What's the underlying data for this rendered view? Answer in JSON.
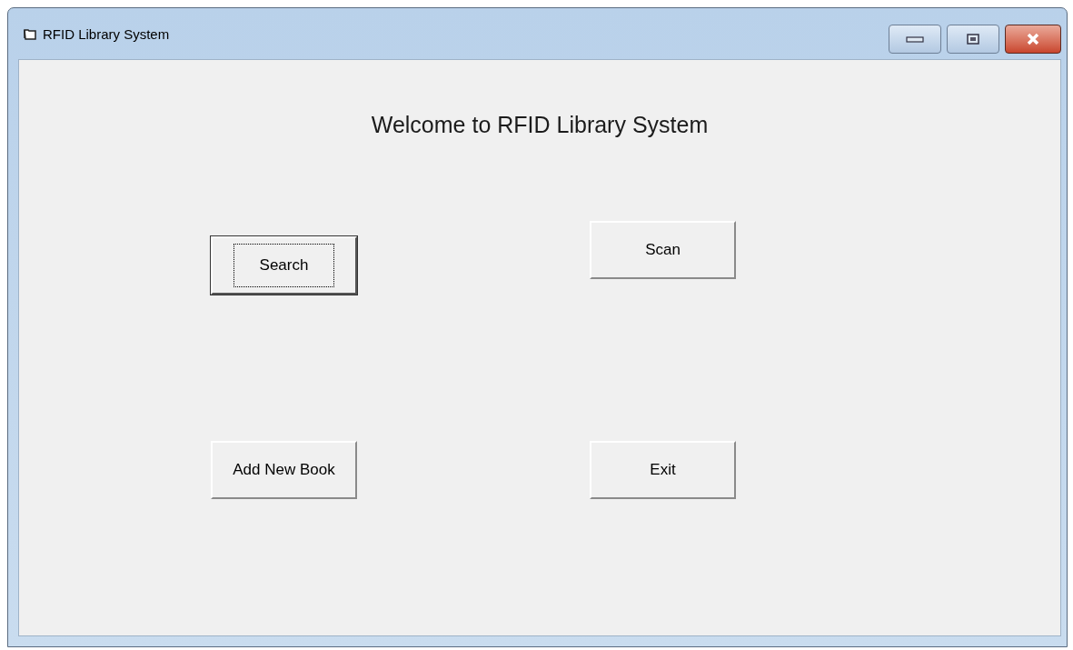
{
  "window": {
    "title": "RFID Library System"
  },
  "heading": "Welcome to RFID Library System",
  "buttons": [
    {
      "label": "Scan",
      "focused": false
    },
    {
      "label": "Search",
      "focused": true
    },
    {
      "label": "Add New Book",
      "focused": false
    },
    {
      "label": "Exit",
      "focused": false
    }
  ]
}
